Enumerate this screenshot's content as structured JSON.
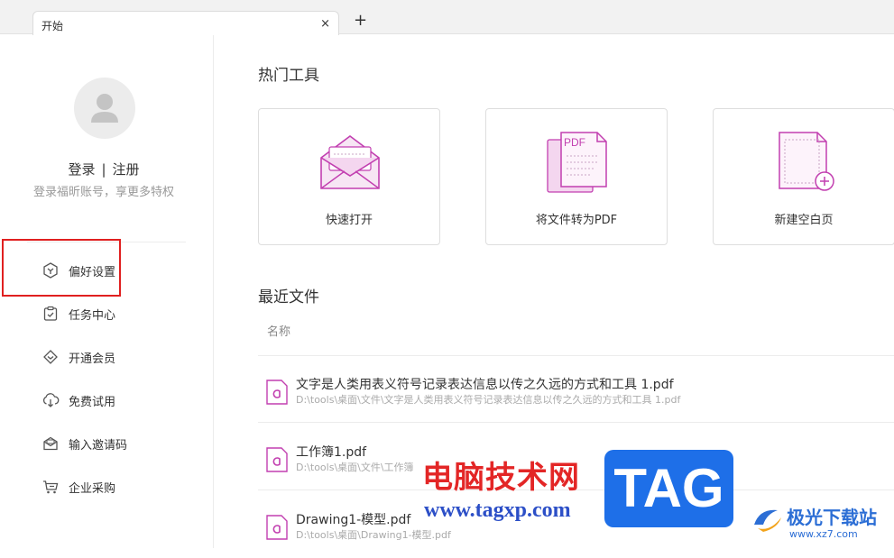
{
  "tabs": [
    {
      "label": "开始"
    }
  ],
  "tab_close": "×",
  "tab_add": "+",
  "sidebar": {
    "login": "登录",
    "separator": "|",
    "register": "注册",
    "login_hint": "登录福昕账号，享更多特权",
    "menu": [
      {
        "label": "偏好设置",
        "icon": "preferences-icon"
      },
      {
        "label": "任务中心",
        "icon": "task-center-icon"
      },
      {
        "label": "开通会员",
        "icon": "membership-icon"
      },
      {
        "label": "免费试用",
        "icon": "free-trial-icon"
      },
      {
        "label": "输入邀请码",
        "icon": "invite-code-icon"
      },
      {
        "label": "企业采购",
        "icon": "enterprise-purchase-icon"
      }
    ]
  },
  "main": {
    "hot_tools_title": "热门工具",
    "tools": [
      {
        "label": "快速打开",
        "icon": "envelope-open-icon"
      },
      {
        "label": "将文件转为PDF",
        "icon": "convert-to-pdf-icon",
        "icon_text": "PDF"
      },
      {
        "label": "新建空白页",
        "icon": "new-blank-page-icon"
      }
    ],
    "recent_title": "最近文件",
    "column_name": "名称",
    "recent_files": [
      {
        "name": "文字是人类用表义符号记录表达信息以传之久远的方式和工具 1.pdf",
        "path": "D:\\tools\\桌面\\文件\\文字是人类用表义符号记录表达信息以传之久远的方式和工具 1.pdf"
      },
      {
        "name": "工作簿1.pdf",
        "path": "D:\\tools\\桌面\\文件\\工作簿"
      },
      {
        "name": "Drawing1-模型.pdf",
        "path": "D:\\tools\\桌面\\Drawing1-模型.pdf"
      }
    ]
  },
  "watermark": {
    "cn": "电脑技术网",
    "url": "www.tagxp.com",
    "tag": "TAG",
    "site": "极光下载站",
    "site_url": "www.xz7.com"
  },
  "colors": {
    "accent": "#c23fb0",
    "highlight": "#e02020"
  }
}
